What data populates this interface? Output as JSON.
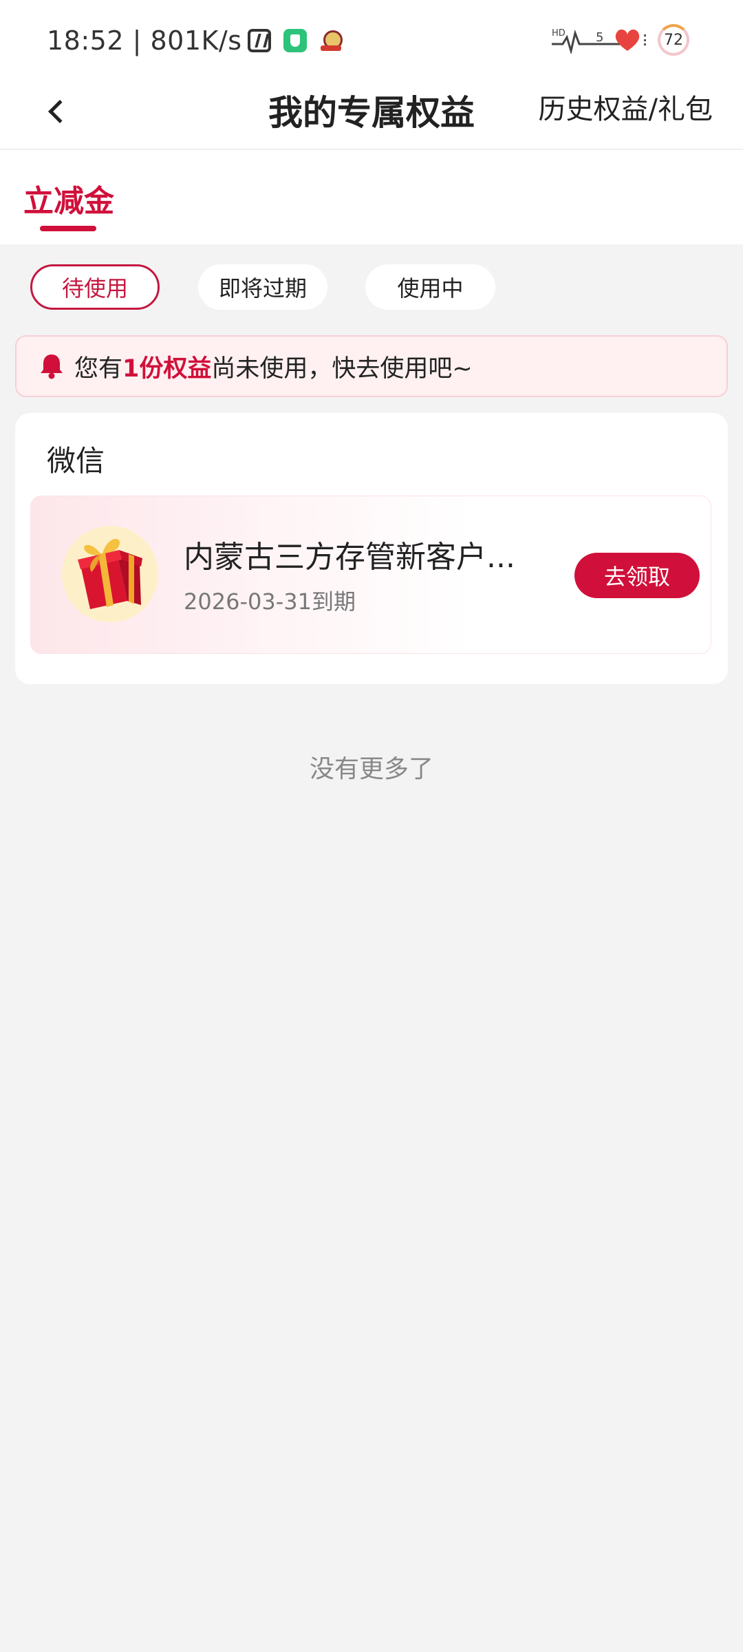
{
  "status_bar": {
    "time": "18:52",
    "network": "801K/s",
    "battery": "72",
    "signal_label": "HD",
    "signal_number": "5"
  },
  "header": {
    "title": "我的专属权益",
    "history_link": "历史权益/礼包"
  },
  "tabs": [
    {
      "label": "立减金",
      "active": true
    }
  ],
  "filters": [
    {
      "label": "待使用",
      "active": true
    },
    {
      "label": "即将过期",
      "active": false
    },
    {
      "label": "使用中",
      "active": false
    }
  ],
  "notice": {
    "prefix": "您有",
    "highlight": "1份权益",
    "suffix": "尚未使用，快去使用吧~"
  },
  "group": {
    "title": "微信",
    "items": [
      {
        "name": "内蒙古三方存管新客户...",
        "expiry": "2026-03-31到期",
        "action": "去领取",
        "icon": "gift-icon"
      }
    ]
  },
  "footer": {
    "no_more": "没有更多了"
  },
  "colors": {
    "accent": "#d0103a",
    "background": "#f3f3f3",
    "notice_bg": "#fff0f1"
  }
}
